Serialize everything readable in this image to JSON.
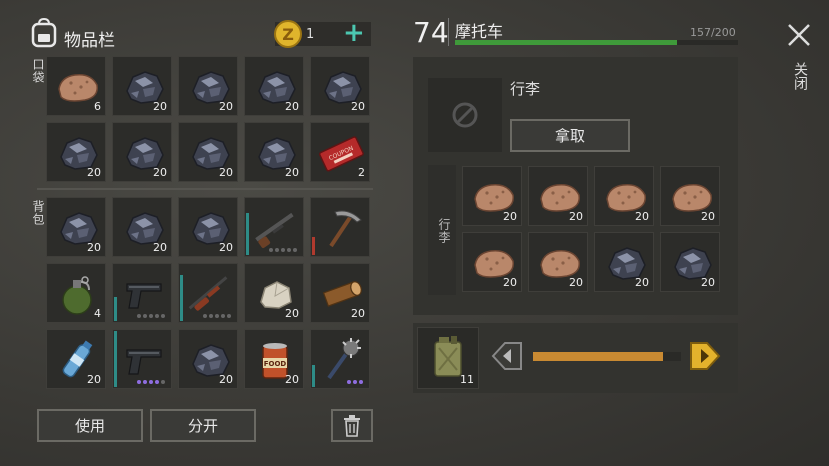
{
  "inventory": {
    "title": "物品栏",
    "coins": "1",
    "pocket_label": "口袋",
    "backpack_label": "背包",
    "pocket_slots": [
      {
        "item": "clay-icon",
        "qty": "6"
      },
      {
        "item": "coal-icon",
        "qty": "20"
      },
      {
        "item": "coal-icon",
        "qty": "20"
      },
      {
        "item": "coal-icon",
        "qty": "20"
      },
      {
        "item": "coal-icon",
        "qty": "20"
      },
      {
        "item": "coal-icon",
        "qty": "20"
      },
      {
        "item": "coal-icon",
        "qty": "20"
      },
      {
        "item": "coal-icon",
        "qty": "20"
      },
      {
        "item": "coal-icon",
        "qty": "20"
      },
      {
        "item": "coupon-icon",
        "qty": "2"
      }
    ],
    "backpack_slots": [
      {
        "item": "coal-icon",
        "qty": "20"
      },
      {
        "item": "coal-icon",
        "qty": "20"
      },
      {
        "item": "coal-icon",
        "qty": "20"
      },
      {
        "item": "shotgun-icon",
        "qty": ""
      },
      {
        "item": "pickaxe-icon",
        "qty": ""
      },
      {
        "item": "grenade-icon",
        "qty": "4"
      },
      {
        "item": "pistol-icon",
        "qty": ""
      },
      {
        "item": "rifle-icon",
        "qty": ""
      },
      {
        "item": "stone-icon",
        "qty": "20"
      },
      {
        "item": "log-icon",
        "qty": "20"
      },
      {
        "item": "water-bottle-icon",
        "qty": "20"
      },
      {
        "item": "pistol-icon",
        "qty": ""
      },
      {
        "item": "coal-icon",
        "qty": "20"
      },
      {
        "item": "food-can-icon",
        "qty": "20"
      },
      {
        "item": "spiked-club-icon",
        "qty": ""
      }
    ],
    "use_button": "使用",
    "split_button": "分开",
    "trash_icon": "trash-icon"
  },
  "vehicle": {
    "level": "74",
    "name": "摩托车",
    "capacity": "157/200",
    "capacity_fraction": 0.785,
    "luggage_title": "行李",
    "take_button": "拿取",
    "grid_label": "行李",
    "slots": [
      {
        "item": "clay-icon",
        "qty": "20"
      },
      {
        "item": "clay-icon",
        "qty": "20"
      },
      {
        "item": "clay-icon",
        "qty": "20"
      },
      {
        "item": "clay-icon",
        "qty": "20"
      },
      {
        "item": "clay-icon",
        "qty": "20"
      },
      {
        "item": "clay-icon",
        "qty": "20"
      },
      {
        "item": "coal-icon",
        "qty": "20"
      },
      {
        "item": "coal-icon",
        "qty": "20"
      }
    ],
    "fuel_qty": "11",
    "fuel_fraction": 0.88
  },
  "close_label": "关闭",
  "colors": {
    "accent": "#4cc7b0",
    "bar": "#3f9a3a",
    "fuel": "#c98a32",
    "coin": "#e0b52c"
  }
}
